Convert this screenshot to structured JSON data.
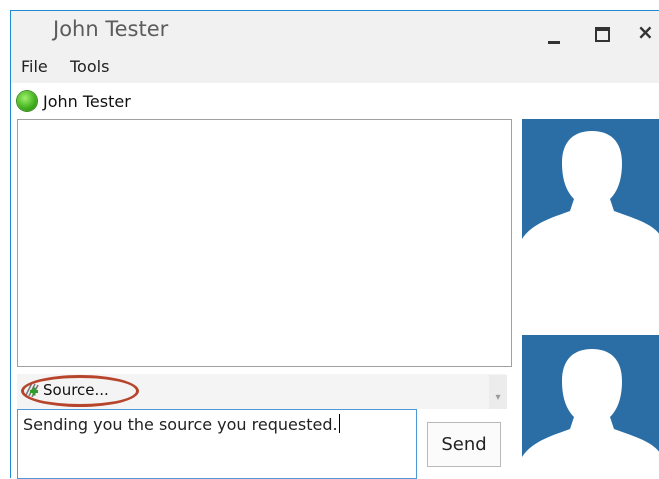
{
  "window": {
    "title": "John Tester",
    "controls": [
      "minimize-icon",
      "maximize-icon",
      "close-icon"
    ],
    "close_glyph": "×"
  },
  "menu": {
    "items": [
      {
        "label": "File"
      },
      {
        "label": "Tools"
      }
    ]
  },
  "contact": {
    "name": "John Tester",
    "status_icon": "online-status-icon",
    "status_color": "#3fae1d"
  },
  "attachment": {
    "label": "Source...",
    "icon": "attach-file-icon"
  },
  "composer": {
    "text": "Sending you the source you requested.",
    "send_label": "Send"
  },
  "avatars": [
    {
      "icon": "person-silhouette-icon",
      "color": "#2b6ea6"
    },
    {
      "icon": "person-silhouette-icon",
      "color": "#2b6ea6"
    }
  ],
  "colors": {
    "accent": "#1f8ad2",
    "highlight": "#b6452c"
  }
}
